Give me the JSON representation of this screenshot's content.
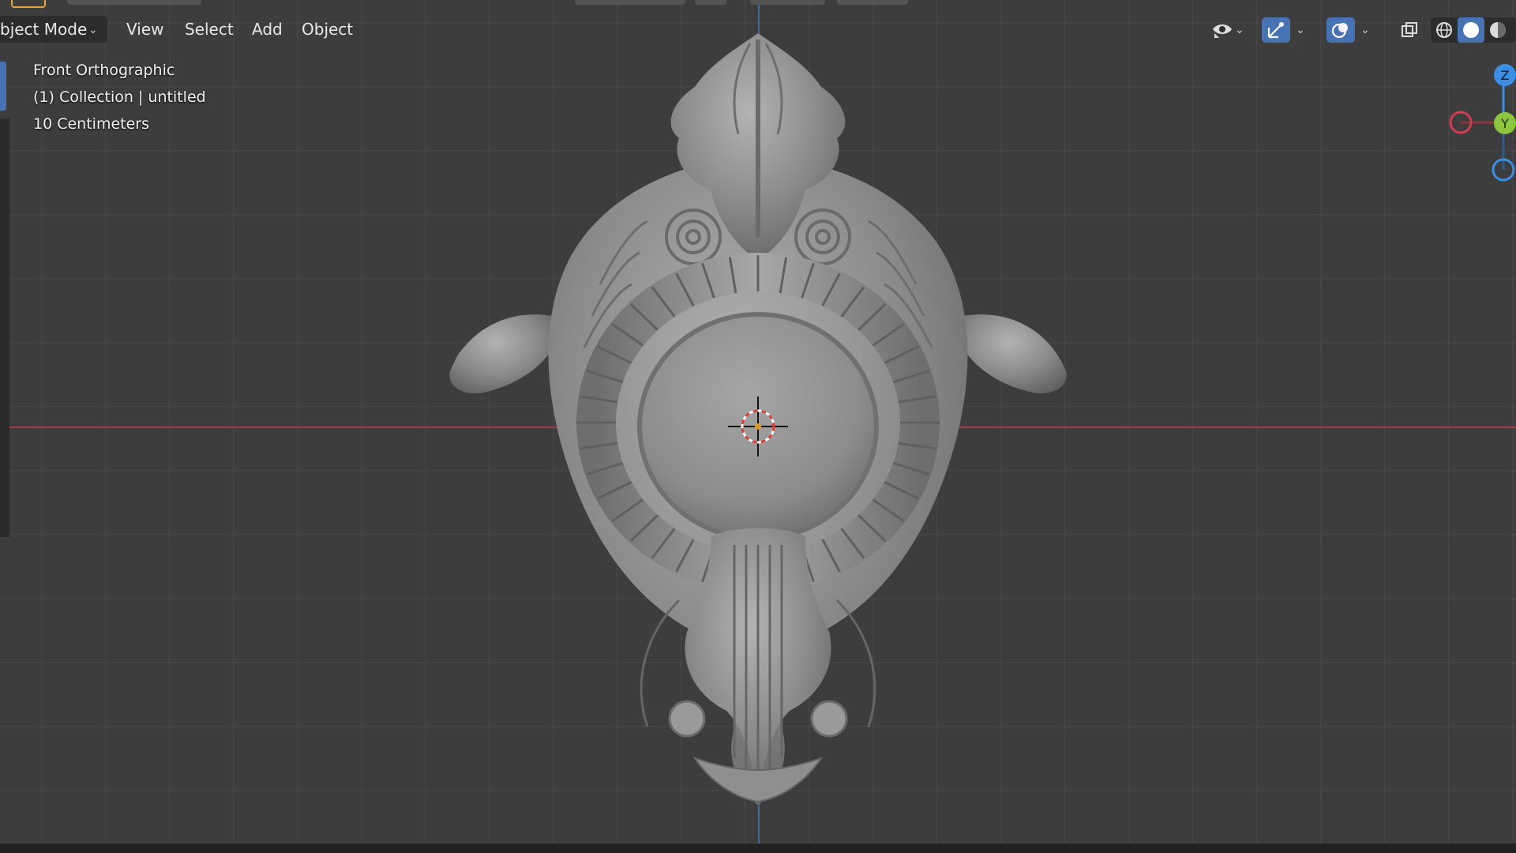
{
  "header": {
    "mode_label": "bject Mode",
    "menu": [
      "View",
      "Select",
      "Add",
      "Object"
    ]
  },
  "viewport": {
    "view_name": "Front Orthographic",
    "collection": "(1) Collection | untitled",
    "scale": "10 Centimeters"
  },
  "gizmo": {
    "z_label": "Z",
    "y_label": "Y"
  },
  "colors": {
    "background": "#3d3d3d",
    "x_axis": "#a33a44",
    "z_axis": "#3e6a9e",
    "gizmo_x": "#d33c4e",
    "gizmo_y": "#8cc63f",
    "gizmo_z": "#3a8ee6",
    "cursor": "#e0402f"
  },
  "icons": [
    "visibility-eye-icon",
    "gizmo-icon",
    "overlay-icon",
    "xray-icon",
    "wireframe-shading-icon",
    "solid-shading-icon",
    "material-shading-icon"
  ]
}
